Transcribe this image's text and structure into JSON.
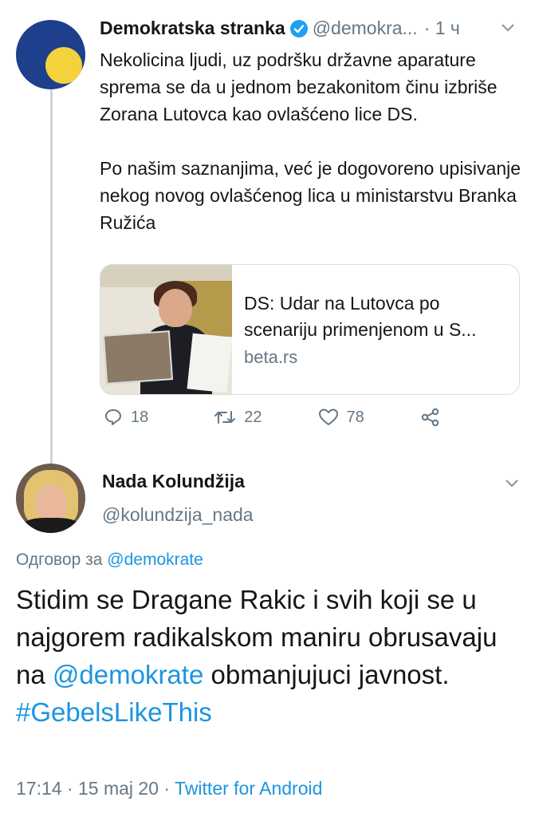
{
  "tweet1": {
    "author_name": "Demokratska stranka",
    "handle": "@demokra...",
    "time": "· 1 ч",
    "text_p1": "Nekolicina ljudi, uz podršku državne aparature sprema se da u jednom bezakonitom činu izbriše Zorana Lutovca kao ovlašćeno lice DS.",
    "text_p2": "Po našim saznanjima, već je dogovoreno upisivanje nekog novog ovlašćenog lica u ministarstvu Branka Ružića",
    "card": {
      "title": "DS: Udar na Lutovca po scenariju primenjenom u S...",
      "source": "beta.rs"
    },
    "actions": {
      "replies": "18",
      "retweets": "22",
      "likes": "78"
    }
  },
  "tweet2": {
    "author_name": "Nada Kolundžija",
    "handle": "@kolundzija_nada",
    "reply_prefix": "Одговор за",
    "reply_to": "@demokrate",
    "text_line1": "Stidim se Dragane Rakic i svih koji se u najgorem radikalskom maniru obrusavaju na",
    "text_mention": "@demokrate",
    "text_line2": "obmanjujuci javnost.",
    "hashtag": "#GebelsLikeThis",
    "timestamp": "17:14 · 15 maj 20 ·",
    "client": "Twitter for Android"
  },
  "colors": {
    "link": "#1b95e0",
    "muted": "#657786",
    "verified": "#1da1f2"
  }
}
